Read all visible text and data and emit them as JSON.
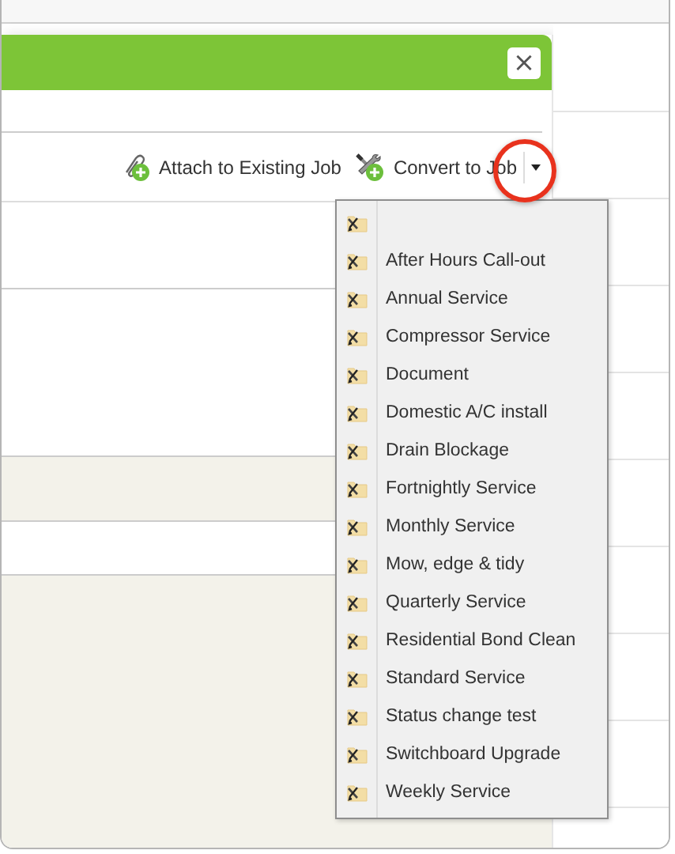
{
  "dialog": {
    "close_label": "×",
    "toolbar": [
      {
        "kind": "attach",
        "label": "Attach to Existing Job"
      },
      {
        "kind": "convert",
        "label": "Convert to Job"
      }
    ]
  },
  "menu": {
    "items": [
      {
        "kind": "blank"
      },
      {
        "kind": "template",
        "label": "After Hours Call-out"
      },
      {
        "kind": "template",
        "label": "Annual Service"
      },
      {
        "kind": "template",
        "label": "Compressor Service"
      },
      {
        "kind": "template",
        "label": "Document"
      },
      {
        "kind": "template",
        "label": "Domestic A/C install"
      },
      {
        "kind": "template",
        "label": "Drain Blockage"
      },
      {
        "kind": "template",
        "label": "Fortnightly Service"
      },
      {
        "kind": "template",
        "label": "Monthly Service"
      },
      {
        "kind": "template",
        "label": "Mow, edge & tidy"
      },
      {
        "kind": "template",
        "label": "Quarterly Service"
      },
      {
        "kind": "template",
        "label": "Residential Bond Clean"
      },
      {
        "kind": "template",
        "label": "Standard Service"
      },
      {
        "kind": "template",
        "label": "Status change test"
      },
      {
        "kind": "template",
        "label": "Switchboard Upgrade"
      },
      {
        "kind": "template",
        "label": "Weekly Service"
      }
    ]
  }
}
